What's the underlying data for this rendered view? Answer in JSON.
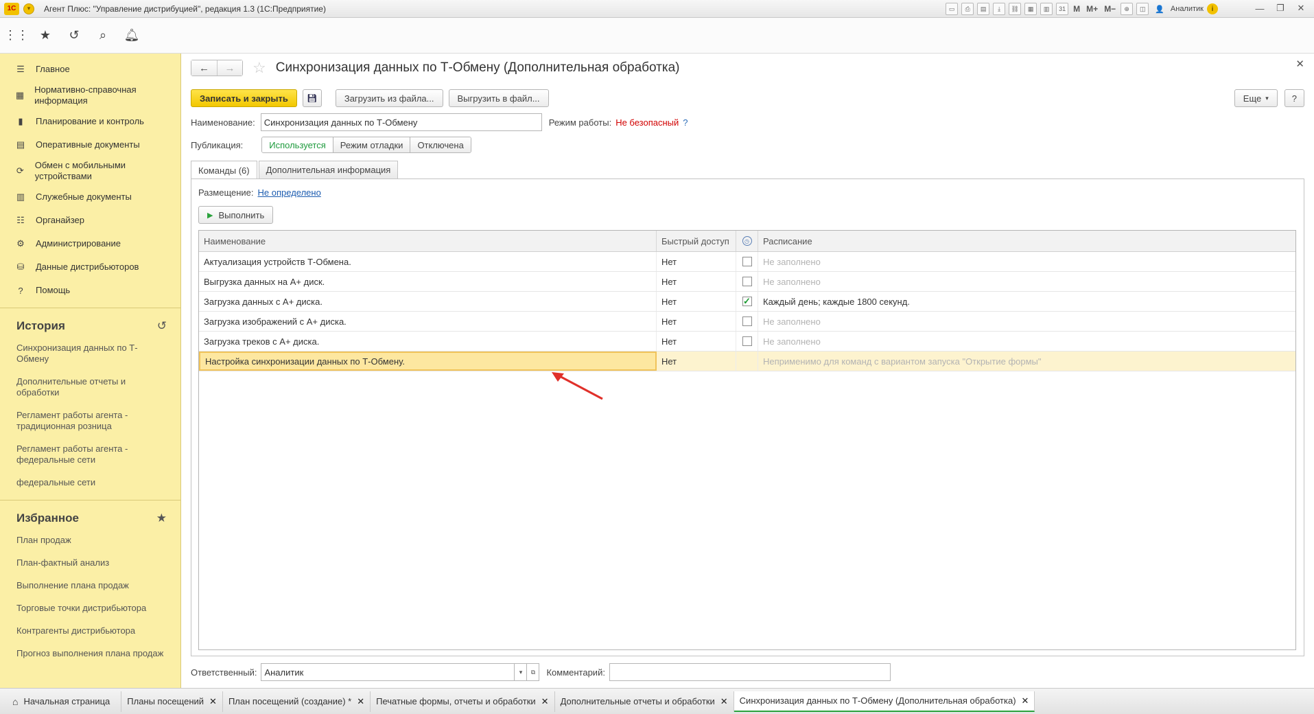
{
  "window": {
    "title": "Агент Плюс: \"Управление дистрибуцией\", редакция 1.3 (1С:Предприятие)",
    "logo_text": "1С",
    "user": "Аналитик"
  },
  "sidebar": {
    "nav": [
      {
        "label": "Главное",
        "icon": "menu-icon"
      },
      {
        "label": "Нормативно-справочная информация",
        "icon": "grid-icon"
      },
      {
        "label": "Планирование и контроль",
        "icon": "chart-icon"
      },
      {
        "label": "Оперативные документы",
        "icon": "documents-icon"
      },
      {
        "label": "Обмен с мобильными устройствами",
        "icon": "sync-icon"
      },
      {
        "label": "Служебные документы",
        "icon": "service-docs-icon"
      },
      {
        "label": "Органайзер",
        "icon": "organizer-icon"
      },
      {
        "label": "Администрирование",
        "icon": "gear-icon"
      },
      {
        "label": "Данные дистрибьюторов",
        "icon": "distributor-icon"
      },
      {
        "label": "Помощь",
        "icon": "help-icon"
      }
    ],
    "history": {
      "title": "История",
      "items": [
        "Синхронизация данных по Т-Обмену",
        "Дополнительные отчеты и обработки",
        "Регламент работы агента - традиционная розница",
        "Регламент работы агента - федеральные сети",
        "федеральные сети"
      ]
    },
    "favorites": {
      "title": "Избранное",
      "items": [
        "План продаж",
        "План-фактный анализ",
        "Выполнение плана продаж",
        "Торговые точки дистрибьютора",
        "Контрагенты дистрибьютора",
        "Прогноз выполнения плана продаж"
      ]
    }
  },
  "form": {
    "title": "Синхронизация данных по Т-Обмену (Дополнительная обработка)",
    "buttons": {
      "save_close": "Записать и закрыть",
      "load_file": "Загрузить из файла...",
      "unload_file": "Выгрузить в файл...",
      "more": "Еще",
      "help": "?"
    },
    "name_label": "Наименование:",
    "name_value": "Синхронизация данных по Т-Обмену",
    "mode_label": "Режим работы:",
    "mode_value": "Не безопасный",
    "mode_help": "?",
    "publication_label": "Публикация:",
    "publication_options": [
      "Используется",
      "Режим отладки",
      "Отключена"
    ],
    "tabs": [
      "Команды (6)",
      "Дополнительная информация"
    ],
    "placement_label": "Размещение:",
    "placement_value": "Не определено",
    "run_button": "Выполнить",
    "grid": {
      "headers": [
        "Наименование",
        "Быстрый доступ",
        "",
        "Расписание"
      ],
      "rows": [
        {
          "name": "Актуализация устройств Т-Обмена.",
          "quick": "Нет",
          "checked": false,
          "schedule": "Не заполнено"
        },
        {
          "name": "Выгрузка данных на А+ диск.",
          "quick": "Нет",
          "checked": false,
          "schedule": "Не заполнено"
        },
        {
          "name": "Загрузка данных с А+ диска.",
          "quick": "Нет",
          "checked": true,
          "schedule": "Каждый день; каждые 1800 секунд."
        },
        {
          "name": "Загрузка изображений с А+ диска.",
          "quick": "Нет",
          "checked": false,
          "schedule": "Не заполнено"
        },
        {
          "name": "Загрузка треков с А+ диска.",
          "quick": "Нет",
          "checked": false,
          "schedule": "Не заполнено"
        },
        {
          "name": "Настройка синхронизации данных по Т-Обмену.",
          "quick": "Нет",
          "checked": null,
          "schedule": "Неприменимо для команд с вариантом запуска \"Открытие формы\""
        }
      ]
    },
    "responsible_label": "Ответственный:",
    "responsible_value": "Аналитик",
    "comment_label": "Комментарий:",
    "comment_value": ""
  },
  "taskbar": {
    "tabs": [
      "Начальная страница",
      "Планы посещений",
      "План посещений (создание) *",
      "Печатные формы, отчеты и обработки",
      "Дополнительные отчеты и обработки",
      "Синхронизация данных по Т-Обмену (Дополнительная обработка)"
    ]
  },
  "colors": {
    "sidebar_bg": "#fbefa6",
    "accent_yellow": "#f2c700",
    "active_green": "#1d9a3c",
    "warning_red": "#d10000",
    "link_blue": "#1c5cb0",
    "selected_row": "#fde7a0",
    "annotation_arrow": "#e0302a"
  }
}
